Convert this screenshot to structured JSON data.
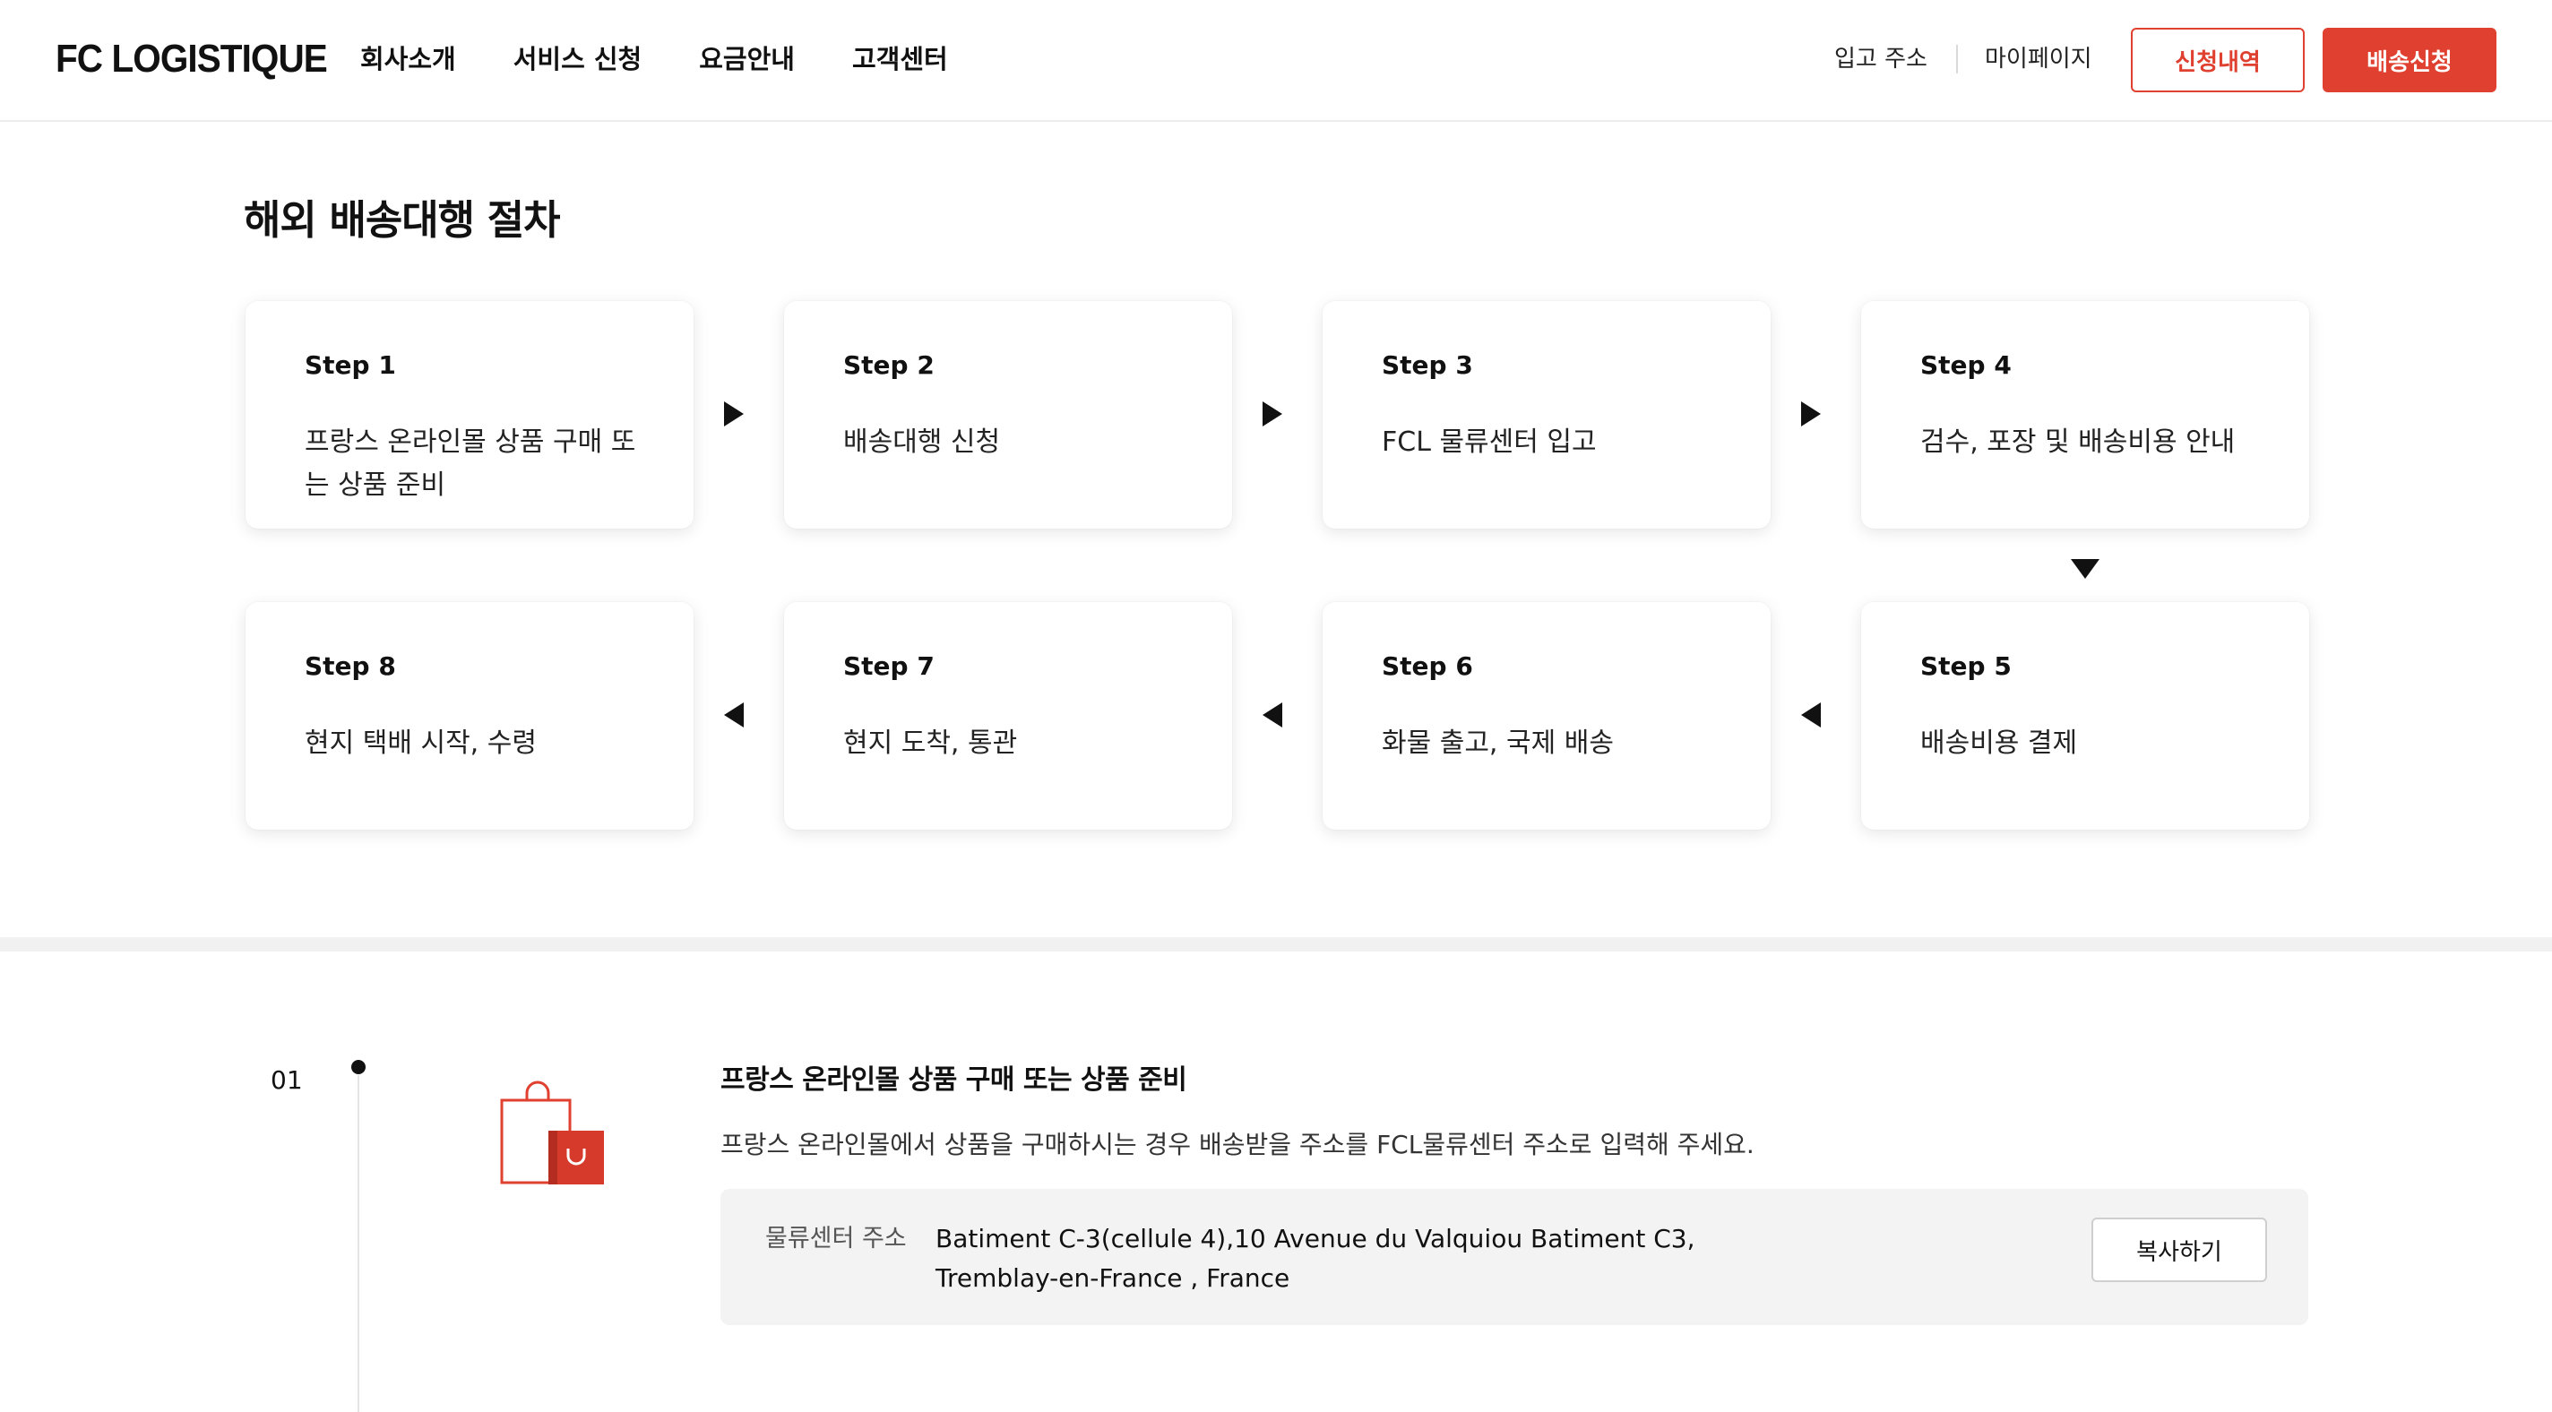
{
  "header": {
    "logo": "FC LOGISTIQUE",
    "nav": [
      "회사소개",
      "서비스 신청",
      "요금안내",
      "고객센터"
    ],
    "util_links": [
      "입고 주소",
      "마이페이지"
    ],
    "btn_history": "신청내역",
    "btn_apply": "배송신청"
  },
  "process": {
    "title": "해외 배송대행 절차",
    "steps": [
      {
        "step": "Step 1",
        "desc": "프랑스 온라인몰 상품 구매 또는 상품 준비"
      },
      {
        "step": "Step 2",
        "desc": "배송대행 신청"
      },
      {
        "step": "Step 3",
        "desc": "FCL 물류센터 입고"
      },
      {
        "step": "Step 4",
        "desc": "검수, 포장 및 배송비용 안내"
      },
      {
        "step": "Step 5",
        "desc": "배송비용 결제"
      },
      {
        "step": "Step 6",
        "desc": "화물 출고, 국제 배송"
      },
      {
        "step": "Step 7",
        "desc": "현지 도착, 통관"
      },
      {
        "step": "Step 8",
        "desc": "현지 택배 시작, 수령"
      }
    ]
  },
  "detail": {
    "number": "01",
    "title": "프랑스 온라인몰 상품 구매 또는 상품 준비",
    "desc": "프랑스 온라인몰에서 상품을 구매하시는 경우 배송받을 주소를 FCL물류센터 주소로 입력해 주세요.",
    "address_label": "물류센터 주소",
    "address_line1": "Batiment C-3(cellule 4),10 Avenue du Valquiou Batiment C3,",
    "address_line2": "Tremblay-en-France , France",
    "copy_label": "복사하기",
    "icon": "shopping-bag-icon"
  },
  "colors": {
    "accent": "#e0402f",
    "text": "#111111",
    "band": "#f1f1f1",
    "address_bg": "#f3f3f3"
  }
}
